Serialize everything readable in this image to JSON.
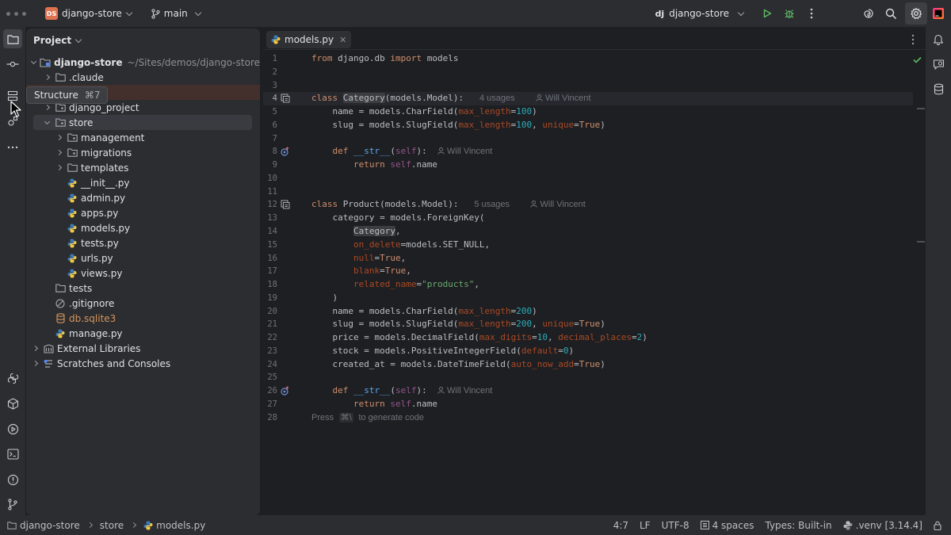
{
  "titlebar": {
    "project_badge": "DS",
    "project_name": "django-store",
    "branch": "main",
    "run_config_prefix": "dj",
    "run_config": "django-store"
  },
  "tooltip": {
    "label": "Structure",
    "shortcut": "⌘7"
  },
  "project_panel": {
    "title": "Project",
    "root": {
      "name": "django-store",
      "path": "~/Sites/demos/django-store"
    },
    "items": [
      {
        "label": ".claude"
      },
      {
        "label": "django_project"
      },
      {
        "label": "store"
      },
      {
        "label": "management"
      },
      {
        "label": "migrations"
      },
      {
        "label": "templates"
      },
      {
        "label": "__init__.py"
      },
      {
        "label": "admin.py"
      },
      {
        "label": "apps.py"
      },
      {
        "label": "models.py"
      },
      {
        "label": "tests.py"
      },
      {
        "label": "urls.py"
      },
      {
        "label": "views.py"
      },
      {
        "label": "tests"
      },
      {
        "label": ".gitignore"
      },
      {
        "label": "db.sqlite3"
      },
      {
        "label": "manage.py"
      },
      {
        "label": "External Libraries"
      },
      {
        "label": "Scratches and Consoles"
      }
    ]
  },
  "editor": {
    "tab_label": "models.py",
    "line_numbers": [
      "1",
      "2",
      "3",
      "4",
      "5",
      "6",
      "7",
      "8",
      "9",
      "10",
      "11",
      "12",
      "13",
      "14",
      "15",
      "16",
      "17",
      "18",
      "19",
      "20",
      "21",
      "22",
      "23",
      "24",
      "25",
      "26",
      "27",
      "28"
    ],
    "hints": {
      "category_usages": "4 usages",
      "product_usages": "5 usages",
      "author": "Will Vincent",
      "generate_pre": "Press",
      "generate_key": "⌘\\",
      "generate_post": "to generate code"
    }
  },
  "statusbar": {
    "crumbs": [
      "django-store",
      "store",
      "models.py"
    ],
    "position": "4:7",
    "line_sep": "LF",
    "encoding": "UTF-8",
    "indent": "4 spaces",
    "types": "Types: Built-in",
    "interpreter": ".venv [3.14.4]"
  }
}
